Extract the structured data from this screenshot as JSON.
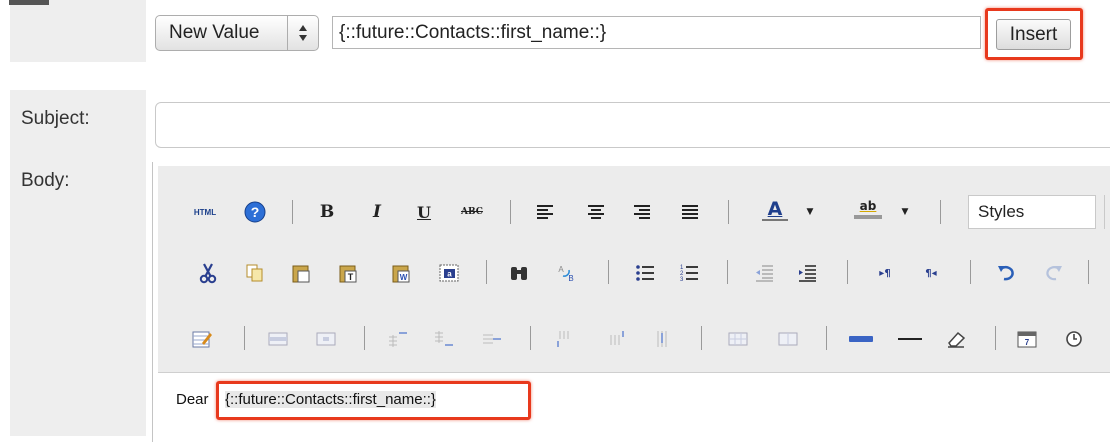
{
  "insert_row": {
    "select_value": "New Value",
    "field_value": "{::future::Contacts::first_name::}",
    "insert_label": "Insert"
  },
  "form": {
    "subject_label": "Subject:",
    "subject_value": "",
    "body_label": "Body:"
  },
  "toolbar": {
    "row1": {
      "html": "HTML",
      "help": "?",
      "bold": "B",
      "italic": "I",
      "underline": "U",
      "strike": "ABC",
      "font_color": "A",
      "highlight": "ab",
      "styles_placeholder": "Styles"
    }
  },
  "body": {
    "prefix": "Dear",
    "token": "{::future::Contacts::first_name::}"
  },
  "colors": {
    "highlight_red": "#e8391d",
    "label_bg": "#eeeeee"
  }
}
